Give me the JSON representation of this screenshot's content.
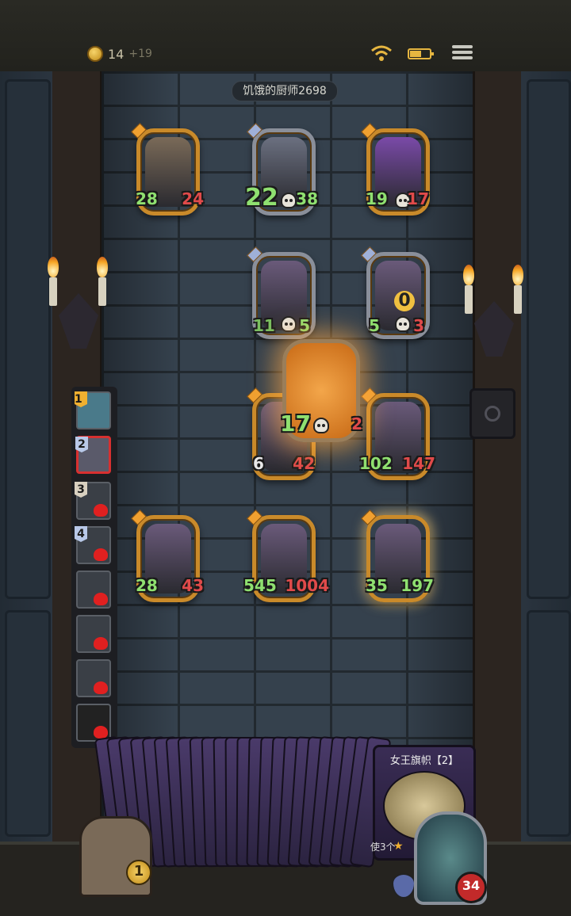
{
  "top": {
    "gold": "14",
    "gold_gain": "+19"
  },
  "enemy_name": "饥饿的厨师2698",
  "enemy_row1": [
    {
      "attack": "28",
      "health": "24",
      "art_color": "#7a6a58"
    },
    {
      "attack": "22",
      "health": "38",
      "art_color": "#6b7080"
    },
    {
      "attack": "19",
      "health": "17",
      "art_color": "#7a4aa8"
    }
  ],
  "enemy_row2": [
    {
      "attack": "11",
      "health": "5",
      "art_color": "#4e7a9a"
    },
    {
      "attack": "5",
      "health": "3",
      "art_color": "#5a6a7a",
      "badge": "0"
    }
  ],
  "flying_card": {
    "attack": "17",
    "health": "2"
  },
  "player_row1": [
    {
      "attack": "6",
      "health": "42",
      "art_color": "#8a6a40"
    },
    {
      "attack": "102",
      "health": "147",
      "art_color": "#6a5a3a"
    }
  ],
  "player_row2": [
    {
      "attack": "28",
      "health": "43",
      "art_color": "#8a5aa8"
    },
    {
      "attack": "545",
      "health": "1004",
      "art_color": "#7a4aa8"
    },
    {
      "attack": "35",
      "health": "197",
      "art_color": "#3a5a8a"
    }
  ],
  "turn_queue": [
    {
      "num": "1",
      "kind": "gold",
      "active": false
    },
    {
      "num": "2",
      "kind": "blue",
      "active": true
    },
    {
      "num": "3",
      "kind": "plain",
      "active": false
    },
    {
      "num": "4",
      "kind": "blue",
      "active": false
    },
    {
      "num": "",
      "kind": "none",
      "active": false
    },
    {
      "num": "",
      "kind": "none",
      "active": false
    },
    {
      "num": "",
      "kind": "none",
      "active": false
    },
    {
      "num": "",
      "kind": "none",
      "active": false
    }
  ],
  "deck": {
    "title": "女王旗帜【2】",
    "text": "使3个"
  },
  "chest_coin": "1",
  "hero_health": "34"
}
